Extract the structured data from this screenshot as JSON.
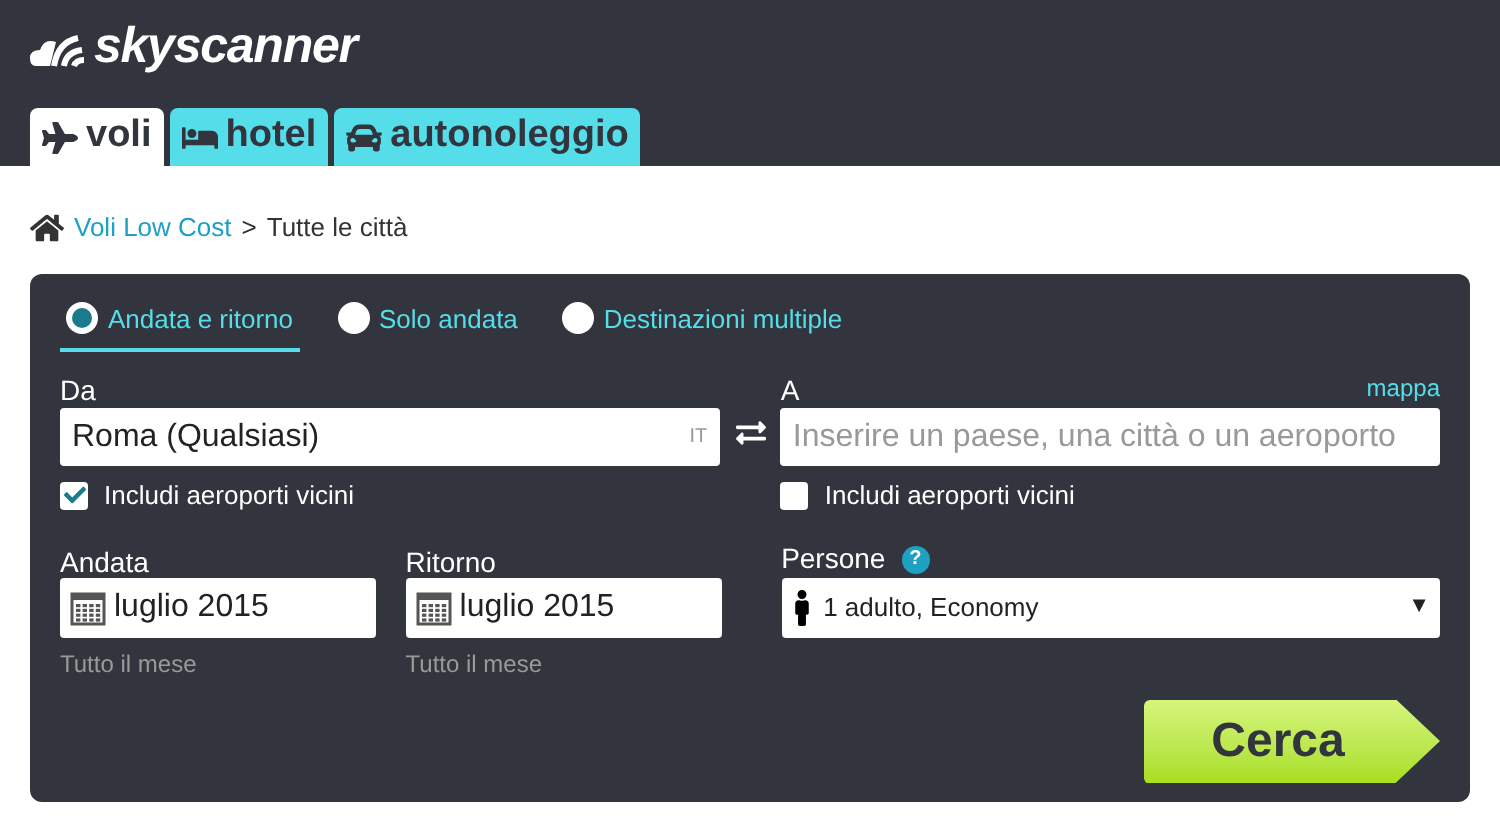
{
  "logo": {
    "text": "skyscanner"
  },
  "tabs": [
    {
      "label": "voli",
      "kind": "plane",
      "selected": true
    },
    {
      "label": "hotel",
      "kind": "bed",
      "selected": false
    },
    {
      "label": "autonoleggio",
      "kind": "car",
      "selected": false
    }
  ],
  "breadcrumb": {
    "link": "Voli Low Cost",
    "separator": ">",
    "current": "Tutte le città"
  },
  "trip_types": [
    {
      "label": "Andata e ritorno",
      "selected": true
    },
    {
      "label": "Solo andata",
      "selected": false
    },
    {
      "label": "Destinazioni multiple",
      "selected": false
    }
  ],
  "from": {
    "label": "Da",
    "value": "Roma (Qualsiasi)",
    "country": "IT",
    "nearby": {
      "label": "Includi aeroporti vicini",
      "checked": true
    }
  },
  "to": {
    "label": "A",
    "map_link": "mappa",
    "placeholder": "Inserire un paese, una città o un aeroporto",
    "nearby": {
      "label": "Includi aeroporti vicini",
      "checked": false
    }
  },
  "dates": [
    {
      "label": "Andata",
      "value": "luglio 2015",
      "hint": "Tutto il mese"
    },
    {
      "label": "Ritorno",
      "value": "luglio 2015",
      "hint": "Tutto il mese"
    }
  ],
  "passengers": {
    "label": "Persone",
    "help": "?",
    "value": "1 adulto, Economy",
    "caret": "▼"
  },
  "search_button": {
    "label": "Cerca"
  }
}
